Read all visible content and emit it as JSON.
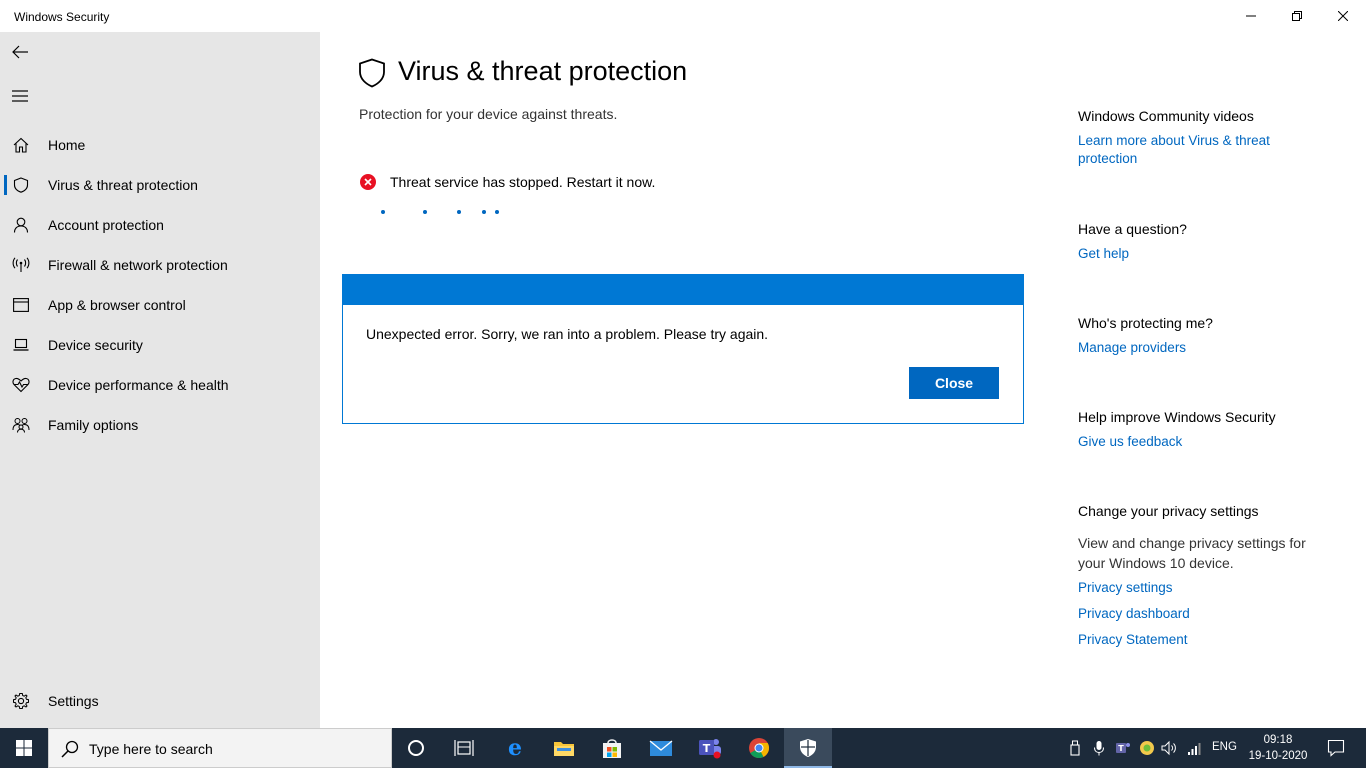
{
  "window": {
    "title": "Windows Security"
  },
  "sidebar": {
    "items": [
      {
        "label": "Home",
        "icon": "home-icon"
      },
      {
        "label": "Virus & threat protection",
        "icon": "shield-icon",
        "active": true
      },
      {
        "label": "Account protection",
        "icon": "person-icon"
      },
      {
        "label": "Firewall & network protection",
        "icon": "antenna-icon"
      },
      {
        "label": "App & browser control",
        "icon": "browser-window-icon"
      },
      {
        "label": "Device security",
        "icon": "laptop-icon"
      },
      {
        "label": "Device performance & health",
        "icon": "heart-pulse-icon"
      },
      {
        "label": "Family options",
        "icon": "family-icon"
      }
    ],
    "settings_label": "Settings"
  },
  "main": {
    "title": "Virus & threat protection",
    "subtitle": "Protection for your device against threats.",
    "threat_status": "Threat service has stopped. Restart it now."
  },
  "dialog": {
    "message": "Unexpected error. Sorry, we ran into a problem.  Please try again.",
    "close_label": "Close"
  },
  "right": {
    "community_heading": "Windows Community videos",
    "community_link": "Learn more about Virus & threat protection",
    "question_heading": "Have a question?",
    "question_link": "Get help",
    "protecting_heading": "Who's protecting me?",
    "protecting_link": "Manage providers",
    "improve_heading": "Help improve Windows Security",
    "improve_link": "Give us feedback",
    "privacy_heading": "Change your privacy settings",
    "privacy_text": "View and change privacy settings for your Windows 10 device.",
    "privacy_links": [
      "Privacy settings",
      "Privacy dashboard",
      "Privacy Statement"
    ]
  },
  "taskbar": {
    "search_placeholder": "Type here to search",
    "language": "ENG",
    "time": "09:18",
    "date": "19-10-2020"
  },
  "colors": {
    "accent": "#0067c0",
    "dialog_bar": "#0078d4",
    "error": "#e81123",
    "sidebar_bg": "#e6e6e6",
    "taskbar_bg": "#1c2a3a"
  }
}
